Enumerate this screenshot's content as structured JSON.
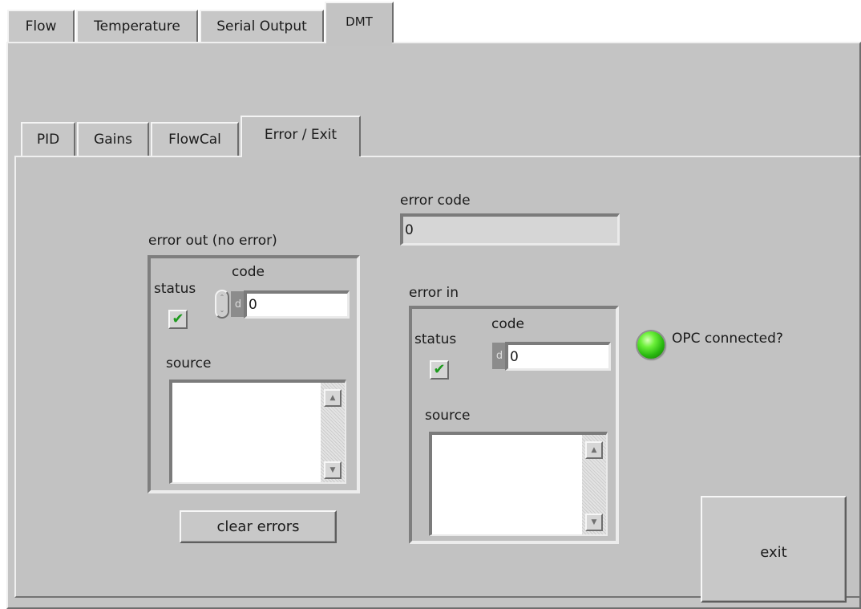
{
  "outer_tabs": [
    {
      "label": "Flow",
      "active": false
    },
    {
      "label": "Temperature",
      "active": false
    },
    {
      "label": "Serial Output",
      "active": false
    },
    {
      "label": "DMT",
      "active": true
    }
  ],
  "inner_tabs": [
    {
      "label": "PID",
      "active": false
    },
    {
      "label": "Gains",
      "active": false
    },
    {
      "label": "FlowCal",
      "active": false
    },
    {
      "label": "Error / Exit",
      "active": true
    }
  ],
  "error_code": {
    "label": "error code",
    "value": "0"
  },
  "error_out": {
    "label": "error out (no error)",
    "status_label": "status",
    "status_checked": true,
    "code_label": "code",
    "code_radix": "d",
    "code_value": "0",
    "source_label": "source",
    "source_value": ""
  },
  "error_in": {
    "label": "error in",
    "status_label": "status",
    "status_checked": true,
    "code_label": "code",
    "code_radix": "d",
    "code_value": "0",
    "source_label": "source",
    "source_value": ""
  },
  "opc": {
    "label": "OPC connected?",
    "on": true
  },
  "buttons": {
    "clear_errors": "clear errors",
    "exit": "exit"
  },
  "glyphs": {
    "check": "✔",
    "up": "▲",
    "down": "▼",
    "spin_up": "⌃",
    "spin_down": "⌄"
  },
  "colors": {
    "panel": "#c4c4c4",
    "led_on": "#3ddb1f",
    "check": "#1e9a1e"
  }
}
